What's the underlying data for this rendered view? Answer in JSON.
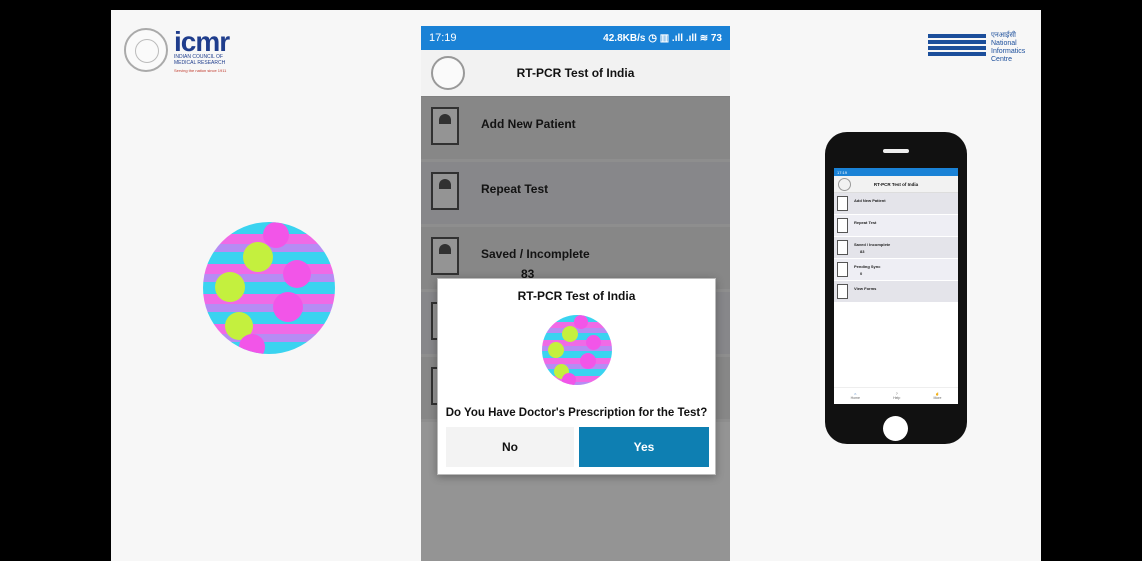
{
  "branding": {
    "icmr_wordmark": "icmr",
    "icmr_subtitle": "INDIAN COUNCIL OF MEDICAL RESEARCH",
    "icmr_tagline": "Serving the nation since 1911",
    "nic_text": "एनआईसी National Informatics Centre"
  },
  "phone": {
    "status": {
      "time": "17:19",
      "right": "42.8KB/s ◷ ▥ .ıll .ıll ≋ 73"
    },
    "app_title": "RT-PCR Test of India",
    "menu": [
      {
        "label": "Add New Patient",
        "count": ""
      },
      {
        "label": "Repeat Test",
        "count": ""
      },
      {
        "label": "Saved / Incomplete",
        "count": "83"
      }
    ],
    "dialog": {
      "title": "RT-PCR Test of India",
      "question": "Do You Have Doctor's Prescription for the Test?",
      "no_label": "No",
      "yes_label": "Yes"
    }
  },
  "mockup": {
    "status": "17:19",
    "app_title": "RT-PCR Test of India",
    "menu": [
      {
        "label": "Add New Patient",
        "count": ""
      },
      {
        "label": "Repeat Test",
        "count": ""
      },
      {
        "label": "Saved / Incomplete",
        "count": "83"
      },
      {
        "label": "Pending Sync",
        "count": "0"
      },
      {
        "label": "View Forms",
        "count": ""
      }
    ],
    "nav": {
      "home": "Home",
      "help": "Help",
      "more": "More"
    }
  },
  "colors": {
    "status_bar": "#1a82d6",
    "yes_button": "#0e7fb2",
    "nic_blue": "#1b4e9b",
    "icmr_blue": "#1f3d8c"
  }
}
